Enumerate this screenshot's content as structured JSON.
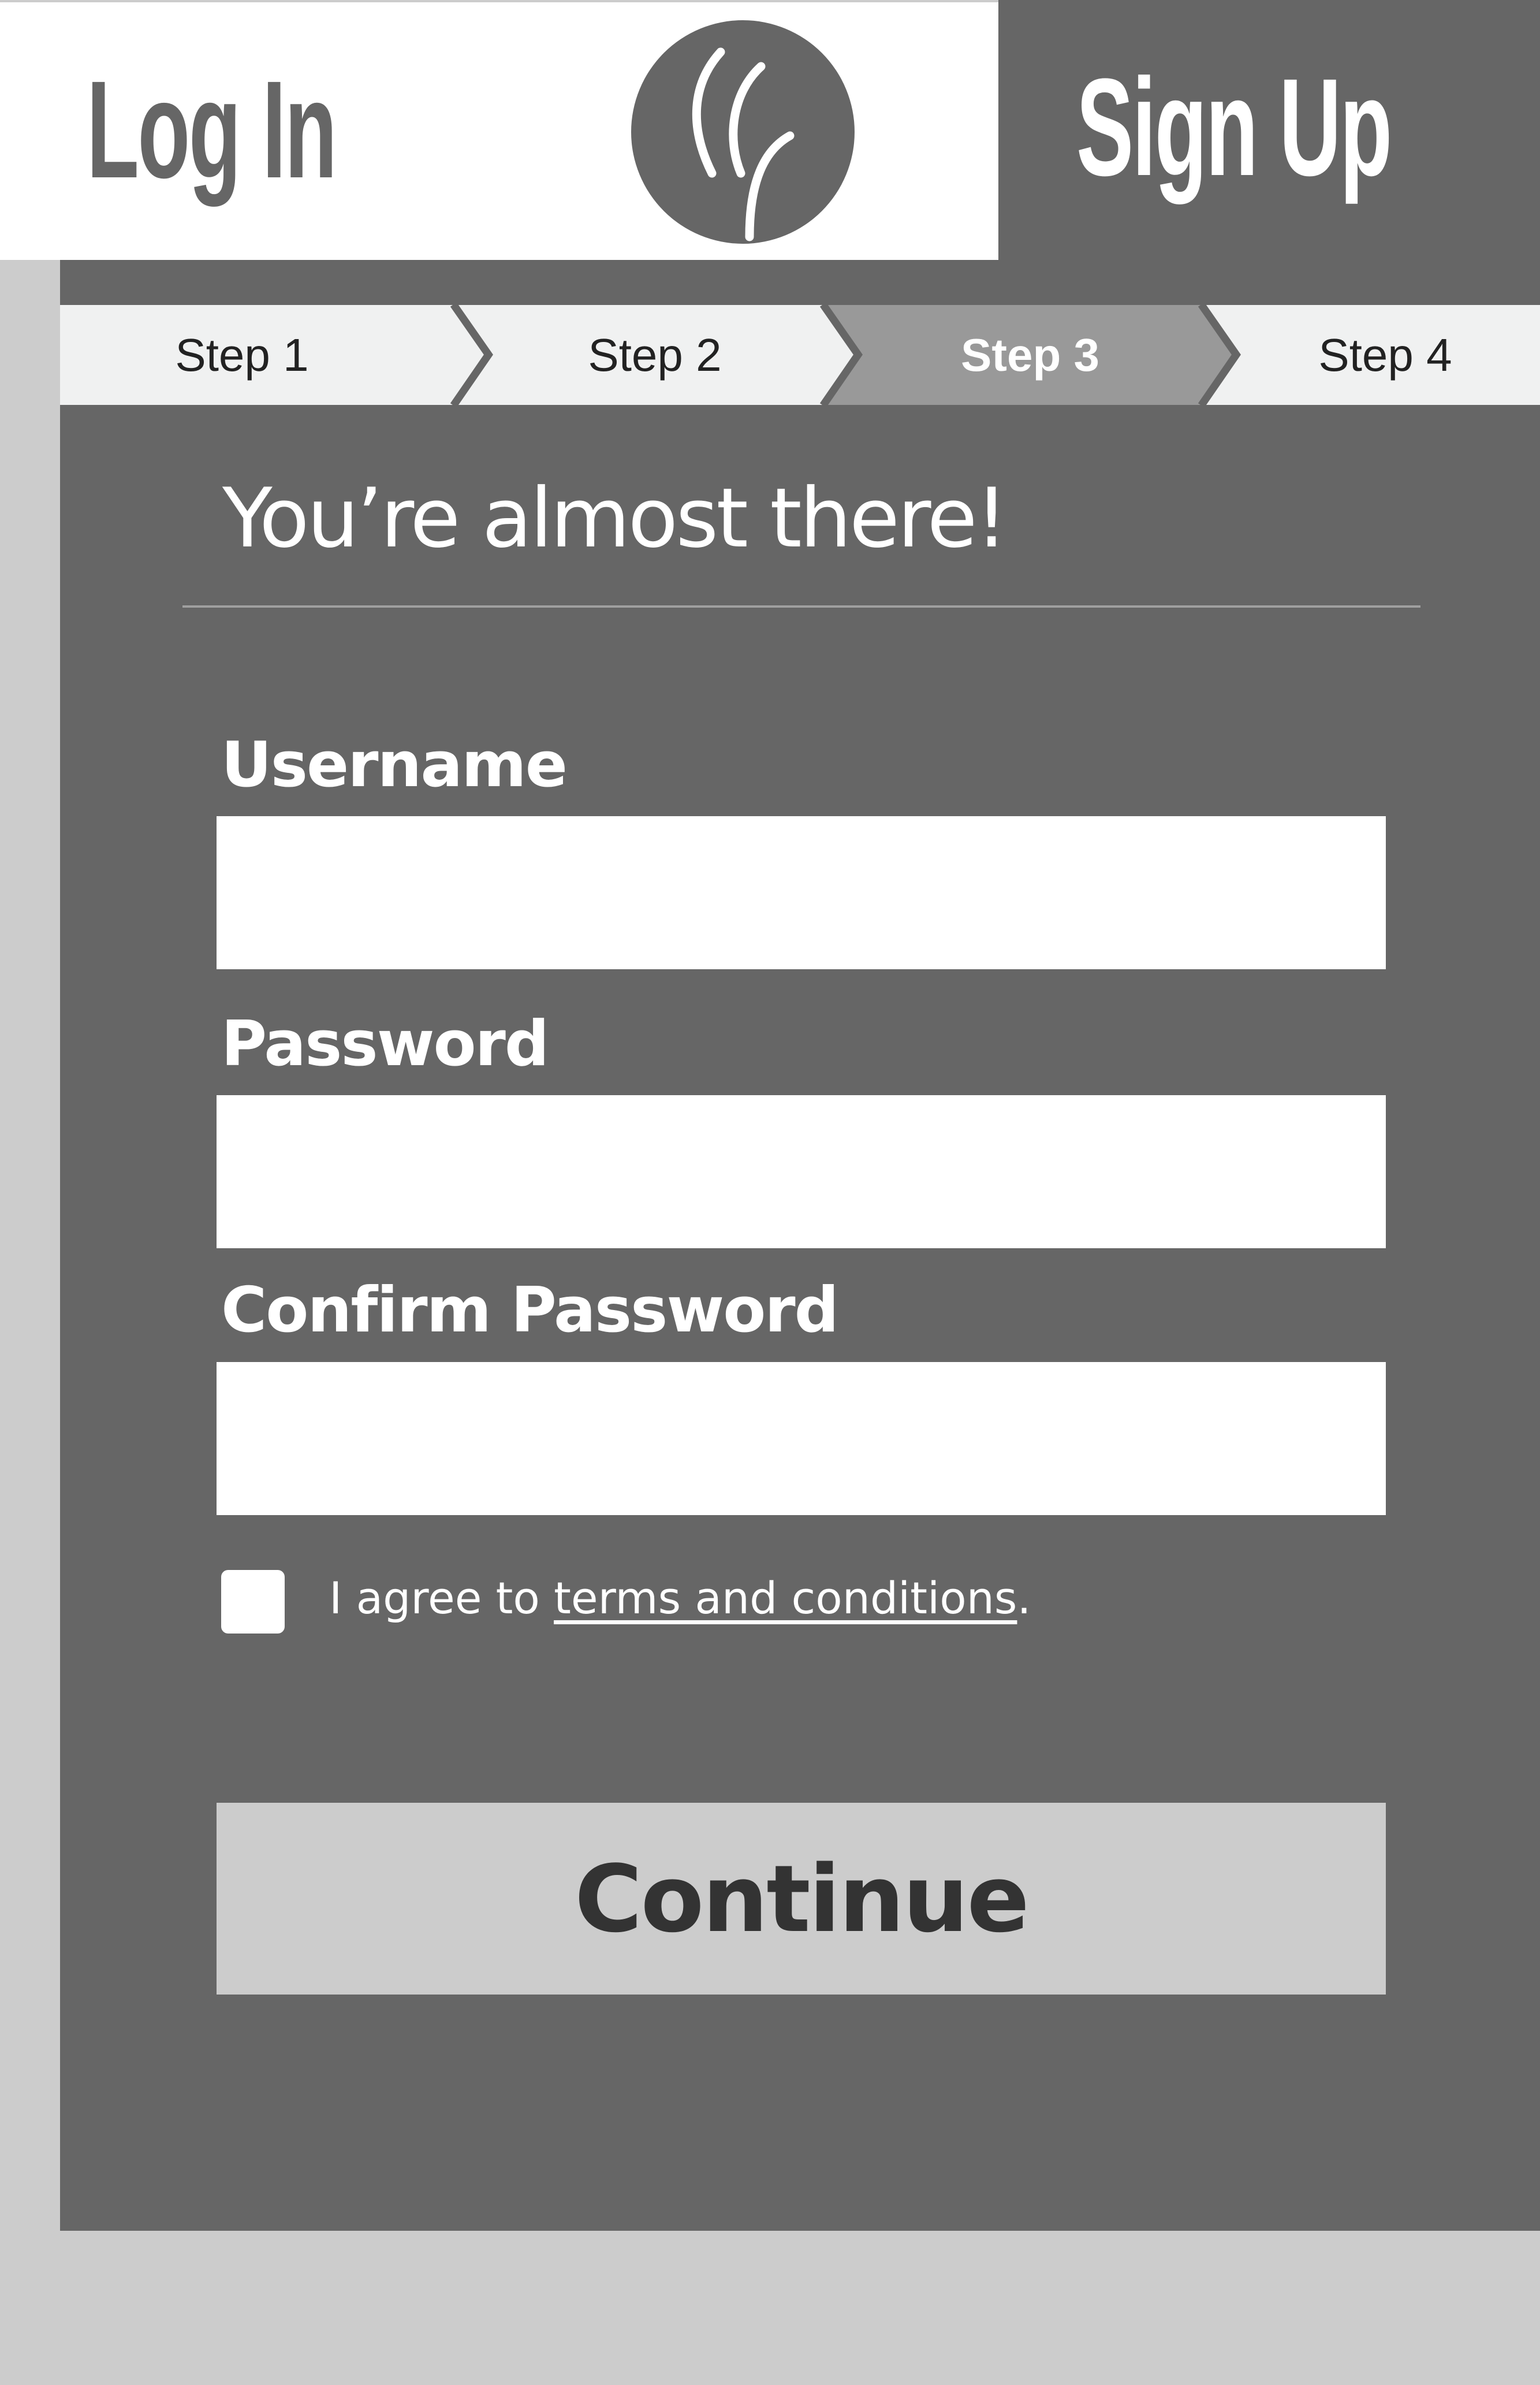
{
  "header": {
    "login_label": "Log In",
    "signup_label": "Sign Up",
    "logo_icon": "leaf-logo-icon"
  },
  "steps": [
    {
      "label": "Step 1",
      "active": false
    },
    {
      "label": "Step 2",
      "active": false
    },
    {
      "label": "Step 3",
      "active": true
    },
    {
      "label": "Step 4",
      "active": false
    }
  ],
  "form": {
    "heading": "You’re almost there!",
    "username_label": "Username",
    "username_value": "",
    "password_label": "Password",
    "password_value": "",
    "confirm_password_label": "Confirm Password",
    "confirm_password_value": "",
    "agree_prefix": "I agree to ",
    "agree_link": "terms and conditions",
    "agree_suffix": ".",
    "terms_checked": false,
    "continue_label": "Continue"
  },
  "colors": {
    "background": "#cccccc",
    "panel": "#666666",
    "active_step": "#999999",
    "inactive_step": "#f0f1f1",
    "white": "#ffffff"
  }
}
